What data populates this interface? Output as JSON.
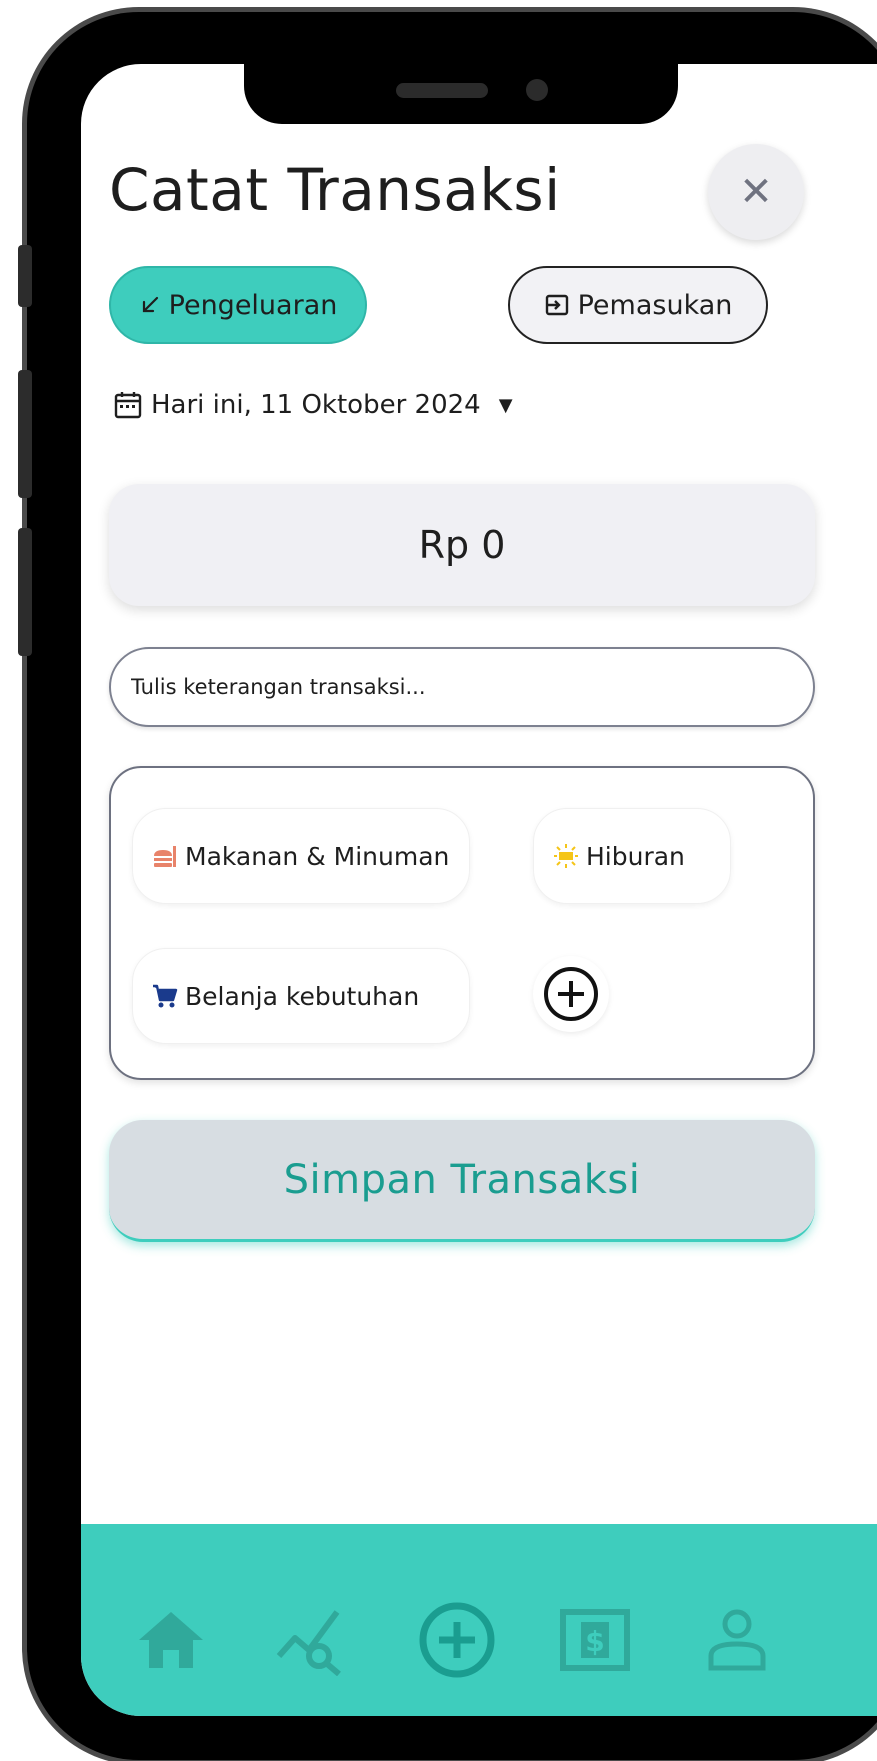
{
  "header": {
    "title": "Catat Transaksi",
    "close_icon": "close-icon"
  },
  "type_toggle": {
    "expense_label": "Pengeluaran",
    "income_label": "Pemasukan",
    "selected": "Pengeluaran"
  },
  "date": {
    "label": "Hari ini, 11 Oktober 2024",
    "icon": "calendar-icon"
  },
  "amount": {
    "value": "Rp 0"
  },
  "note": {
    "placeholder": "Tulis keterangan transaksi..."
  },
  "categories": [
    {
      "label": "Makanan & Minuman",
      "icon": "food-icon"
    },
    {
      "label": "Hiburan",
      "icon": "sun-icon"
    },
    {
      "label": "Belanja kebutuhan",
      "icon": "cart-icon"
    }
  ],
  "save": {
    "label": "Simpan Transaksi"
  },
  "bottom_nav": [
    {
      "icon": "home-icon"
    },
    {
      "icon": "analytics-icon"
    },
    {
      "icon": "add-circle-icon"
    },
    {
      "icon": "money-icon"
    },
    {
      "icon": "profile-icon"
    }
  ],
  "colors": {
    "accent": "#3ecdbd",
    "accent_dark": "#1a9d90",
    "nav_icon": "#30a99b",
    "food_icon": "#e8836a",
    "sun_icon": "#f5c518",
    "cart_icon": "#1a3a8c"
  }
}
